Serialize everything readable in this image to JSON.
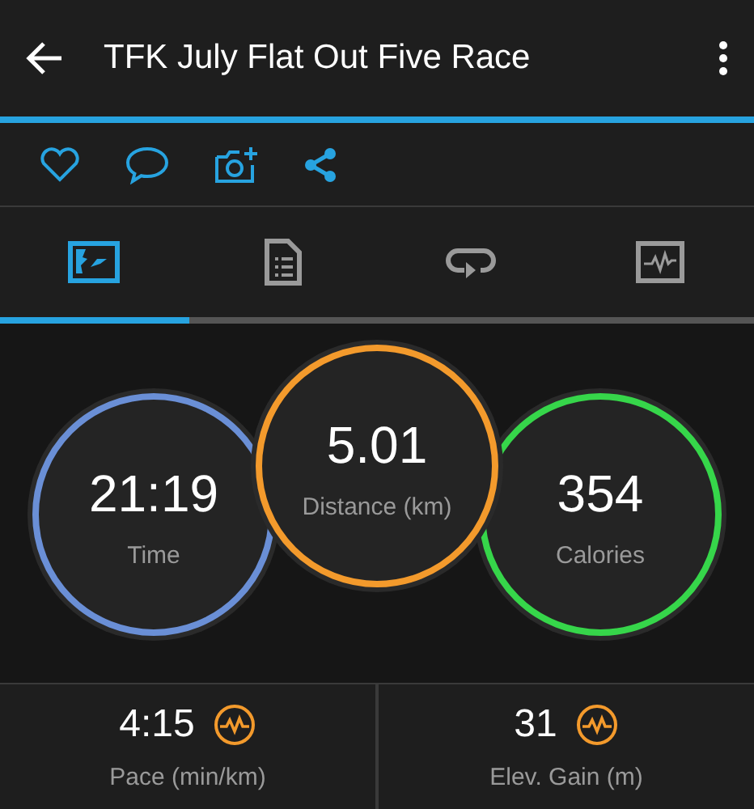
{
  "header": {
    "title": "TFK July Flat Out Five Race"
  },
  "tabs": [
    {
      "kind": "map",
      "selected": true
    },
    {
      "kind": "details",
      "selected": false
    },
    {
      "kind": "laps",
      "selected": false
    },
    {
      "kind": "graph",
      "selected": false
    }
  ],
  "rings": [
    {
      "value": "21:19",
      "label": "Time",
      "color": "#6a8fd6"
    },
    {
      "value": "5.01",
      "label": "Distance (km)",
      "color": "#f39a2c"
    },
    {
      "value": "354",
      "label": "Calories",
      "color": "#36d64a"
    }
  ],
  "stats": [
    {
      "value": "4:15",
      "label": "Pace (min/km)"
    },
    {
      "value": "31",
      "label": "Elev. Gain (m)"
    }
  ]
}
